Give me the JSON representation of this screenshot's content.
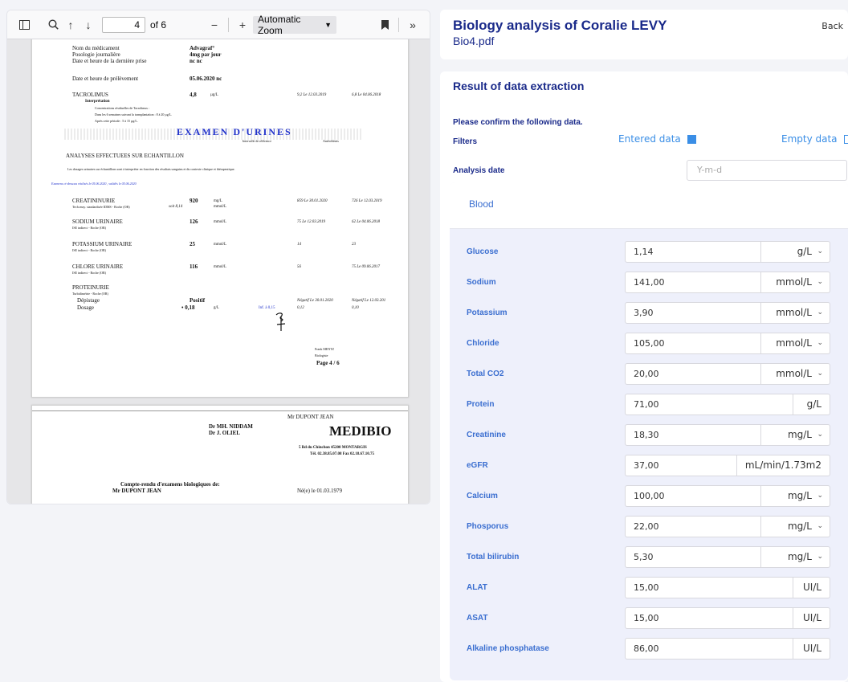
{
  "viewer": {
    "page_current": "4",
    "page_total": "of 6",
    "zoom": "Automatic Zoom"
  },
  "pdf_page1": {
    "nom_label": "Nom du médicament",
    "nom_val": "Advagraf°",
    "posologie_label": "Posologie journalière",
    "posologie_val": "4mg par jour",
    "date_prise_label": "Date et heure de la dernière prise",
    "date_prise_val": "nc   nc",
    "date_prelev_label": "Date et heure de prélèvement",
    "date_prelev_val": "05.06.2020   nc",
    "tacro_name": "TACROLIMUS",
    "tacro_value": "4,8",
    "tacro_unit": "µg/L",
    "tacro_prev1": "9,2  Le 12.03.2019",
    "tacro_prev2": "6,8  Le 04.06.2018",
    "interp": "Interprétation",
    "interp1": "Concentrations résiduelles de Tacrolimus :",
    "interp2": "Dans les 6 semaines suivant la transplantation : 8 à 20 µg/L.",
    "interp3": "Après cette période : 5 à 15 µg/L.",
    "exam_title": "EXAMEN D'URINES",
    "ref_interval": "Intervalle de référence",
    "antecedents": "Antécédents",
    "analyses": "ANALYSES EFFECTUEES SUR ECHANTILLON",
    "dosages_note": "Les dosages urinaires sur échantillons sont à interpréter en fonction des résultats sanguins et du contexte clinique et thérapeutique.",
    "exam_note": "Examens ci-dessous réalisés le 05.06.2020   , validés le 05.06.2020",
    "crea_name": "CREATININURIE",
    "crea_method": "Tech.enzy. standardisée IDMS - Roche (OR)",
    "crea_value": "920",
    "crea_unit": "mg/L",
    "crea_soit": "soit   8,14",
    "crea_unit2": "mmol/L",
    "crea_prev1": "859  Le 30.01.2020",
    "crea_prev2": "726  Le 12.03.2019",
    "sod_name": "SODIUM URINAIRE",
    "sod_method": "ISE indirect - Roche (OR)",
    "sod_value": "126",
    "sod_unit": "mmol/L",
    "sod_prev1": "75  Le 12.03.2019",
    "sod_prev2": "62  Le 04.06.2018",
    "pot_name": "POTASSIUM URINAIRE",
    "pot_method": "ISE indirect - Roche (OR)",
    "pot_value": "25",
    "pot_unit": "mmol/L",
    "pot_prev1": "14",
    "pot_prev2": "23",
    "chl_name": "CHLORE URINAIRE",
    "chl_method": "ISE indirect - Roche (OR)",
    "chl_value": "116",
    "chl_unit": "mmol/L",
    "chl_prev1": "56",
    "chl_prev2": "75  Le 09.06.2017",
    "prot_name": "PROTEINURIE",
    "prot_method": "Turbidimétrie - Roche (OR)",
    "dep_label": "Dépistage",
    "dep_value": "Positif",
    "dep_prev1": "Négatif  Le 30.01.2020",
    "dep_prev2": "Négatif  Le 12.03.201",
    "dos_label": "Dosage",
    "dos_value": "• 0,18",
    "dos_unit": "g/L",
    "dos_ref": "Inf. à 0,15",
    "dos_prev1": "0,12",
    "dos_prev2": "0,10",
    "bio_name": "Frank MENTZ",
    "bio_title": "Biologiste",
    "page_label": "Page  4 / 6"
  },
  "pdf_page2": {
    "doctor1": "Dr MH. NIDDAM",
    "doctor2": "Dr J. OLIEL",
    "patient_top": "Mr DUPONT JEAN",
    "lab_name": "MEDIBIO",
    "lab_address": "5 Bd du Chinchon 45200 MONTARGIS",
    "lab_tel": "Tél. 02.38.85.07.08  Fax 02.18.67.10.75",
    "compte_rendu": "Compte-rendu d'examens biologiques de:",
    "patient": "Mr DUPONT JEAN",
    "born": "Né(e) le 01.03.1979"
  },
  "header": {
    "title": "Biology analysis of Coralie LEVY",
    "file": "Bio4.pdf",
    "back": "Back"
  },
  "result": {
    "title": "Result of data extraction",
    "confirm": "Please confirm the following data.",
    "filters_label": "Filters",
    "entered_data": "Entered data",
    "empty_data": "Empty data",
    "analysis_date_label": "Analysis date",
    "analysis_date_placeholder": "Y-m-d",
    "blood_tab": "Blood"
  },
  "rows": [
    {
      "label": "Glucose",
      "value": "1,14",
      "unit": "g/L"
    },
    {
      "label": "Sodium",
      "value": "141,00",
      "unit": "mmol/L"
    },
    {
      "label": "Potassium",
      "value": "3,90",
      "unit": "mmol/L"
    },
    {
      "label": "Chloride",
      "value": "105,00",
      "unit": "mmol/L"
    },
    {
      "label": "Total CO2",
      "value": "20,00",
      "unit": "mmol/L"
    },
    {
      "label": "Protein",
      "value": "71,00",
      "unit": "g/L"
    },
    {
      "label": "Creatinine",
      "value": "18,30",
      "unit": "mg/L"
    },
    {
      "label": "eGFR",
      "value": "37,00",
      "unit": "mL/min/1.73m2"
    },
    {
      "label": "Calcium",
      "value": "100,00",
      "unit": "mg/L"
    },
    {
      "label": "Phosporus",
      "value": "22,00",
      "unit": "mg/L"
    },
    {
      "label": "Total bilirubin",
      "value": "5,30",
      "unit": "mg/L"
    },
    {
      "label": "ALAT",
      "value": "15,00",
      "unit": "UI/L"
    },
    {
      "label": "ASAT",
      "value": "15,00",
      "unit": "UI/L"
    },
    {
      "label": "Alkaline phosphatase",
      "value": "86,00",
      "unit": "UI/L"
    }
  ],
  "colors": {
    "title_blue": "#1a2a8a",
    "label_blue": "#3a6ed0",
    "accent": "#3a8ee6",
    "panel_bg": "#eef0fb"
  }
}
